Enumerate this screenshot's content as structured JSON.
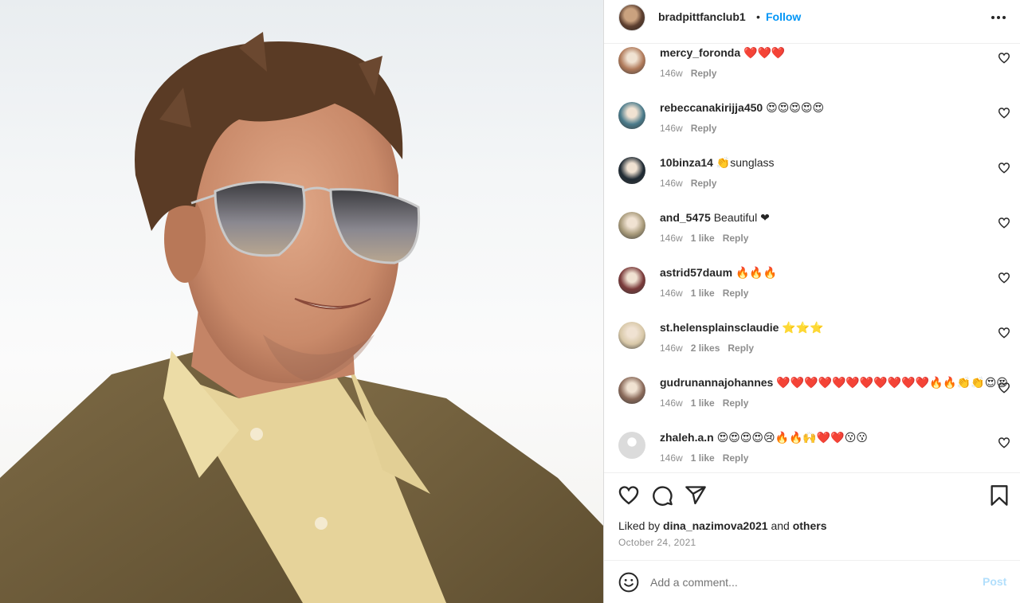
{
  "post": {
    "username": "bradpittfanclub1",
    "separator": "•",
    "follow_label": "Follow",
    "more_icon": "more-horizontal-icon"
  },
  "comments": [
    {
      "username": "mercy_foronda",
      "text": "❤️❤️❤️",
      "age": "146w",
      "likes": "",
      "reply": "Reply",
      "avatar_color": "#b07a5a"
    },
    {
      "username": "rebeccanakirijja450",
      "text": "😍😍😍😍😍",
      "age": "146w",
      "likes": "",
      "reply": "Reply",
      "avatar_color": "#4a7a8a"
    },
    {
      "username": "10binza14",
      "text": "👏sunglass",
      "age": "146w",
      "likes": "",
      "reply": "Reply",
      "avatar_color": "#1f2a33"
    },
    {
      "username": "and_5475",
      "text": "Beautiful ❤",
      "age": "146w",
      "likes": "1 like",
      "reply": "Reply",
      "avatar_color": "#a89a7a"
    },
    {
      "username": "astrid57daum",
      "text": "🔥🔥🔥",
      "age": "146w",
      "likes": "1 like",
      "reply": "Reply",
      "avatar_color": "#7a3a3a"
    },
    {
      "username": "st.helensplainsclaudie",
      "text": "⭐⭐⭐",
      "age": "146w",
      "likes": "2 likes",
      "reply": "Reply",
      "avatar_color": "#d8c8a8"
    },
    {
      "username": "gudrunannajohannes",
      "text": "❤️❤️❤️❤️❤️❤️❤️❤️❤️❤️❤️🔥🔥👏👏😍😍",
      "age": "146w",
      "likes": "1 like",
      "reply": "Reply",
      "avatar_color": "#8a6a5a"
    },
    {
      "username": "zhaleh.a.n",
      "text": "😍😍😍😍😢🔥🔥🙌❤️❤️😗😗",
      "age": "146w",
      "likes": "1 like",
      "reply": "Reply",
      "avatar_color": "#dbdbdb"
    }
  ],
  "actions": {
    "like_icon": "heart-icon",
    "comment_icon": "comment-icon",
    "share_icon": "send-icon",
    "save_icon": "bookmark-icon"
  },
  "likes": {
    "prefix": "Liked by",
    "user": "dina_nazimova2021",
    "and": "and",
    "others": "others"
  },
  "date": "October 24, 2021",
  "add_comment": {
    "placeholder": "Add a comment...",
    "post_label": "Post",
    "emoji_icon": "smiley-icon"
  }
}
